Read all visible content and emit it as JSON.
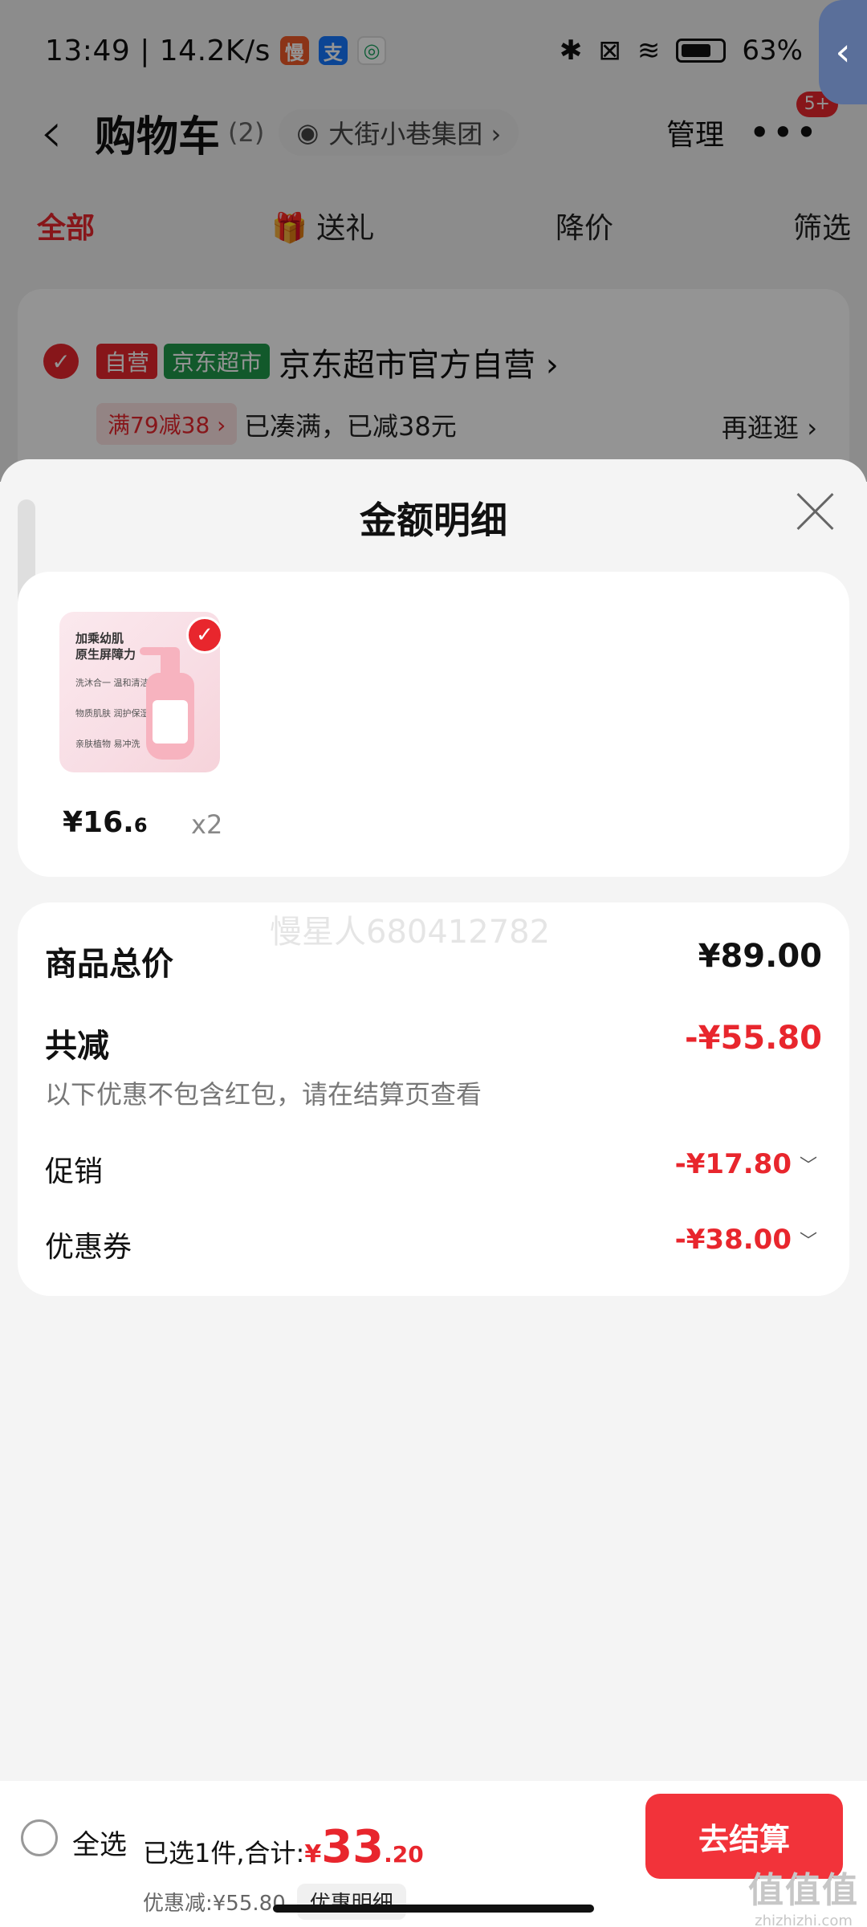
{
  "status": {
    "time": "13:49 | 14.2K/s",
    "app_icons": [
      "慢",
      "支",
      "◎"
    ],
    "battery": "63%"
  },
  "navbar": {
    "back_icon": "‹",
    "title": "购物车",
    "count": "(2)",
    "store_selector": "大街小巷集团 ›",
    "manage": "管理",
    "more_icon": "•••",
    "badge": "5+"
  },
  "tabs": [
    {
      "label": "全部",
      "active": true
    },
    {
      "label": "送礼"
    },
    {
      "label": "降价"
    },
    {
      "label": "筛选"
    }
  ],
  "store": {
    "tag_self": "自营",
    "tag_market": "京东超市",
    "name": "京东超市官方自营 ›",
    "promo_tag": "满79减38 ›",
    "promo_text": "已凑满，已减38元",
    "go_more": "再逛逛 ›"
  },
  "sheet": {
    "title": "金额明细",
    "item": {
      "thumb_line1": "加乘幼肌",
      "thumb_line2": "原生屏障力",
      "thumb_line3": "洗沐合一 温和清洁",
      "thumb_line4": "物质肌肤 润护保湿",
      "thumb_line5": "亲肤植物 易冲洗",
      "price_main": "¥16.",
      "price_dec": "6",
      "qty": "x2"
    },
    "watermark": "慢星人680412782",
    "summary": {
      "total_label": "商品总价",
      "total_value": "¥89.00",
      "reduce_label": "共减",
      "reduce_value": "-¥55.80",
      "note": "以下优惠不包含红包，请在结算页查看",
      "promo_label": "促销",
      "promo_value": "-¥17.80",
      "coupon_label": "优惠券",
      "coupon_value": "-¥38.00"
    }
  },
  "bottom": {
    "select_all": "全选",
    "selected_text": "已选1件,合计:",
    "yen": "¥",
    "total_int": "33",
    "total_dec": ".20",
    "discount_text": "优惠减:¥55.80",
    "detail_button": "优惠明细",
    "checkout": "去结算",
    "corner_logo_big": "值值值",
    "corner_logo_small": "zhizhizhi.com"
  },
  "colors": {
    "accent_red": "#e8262d",
    "market_green": "#1f9a4b"
  }
}
